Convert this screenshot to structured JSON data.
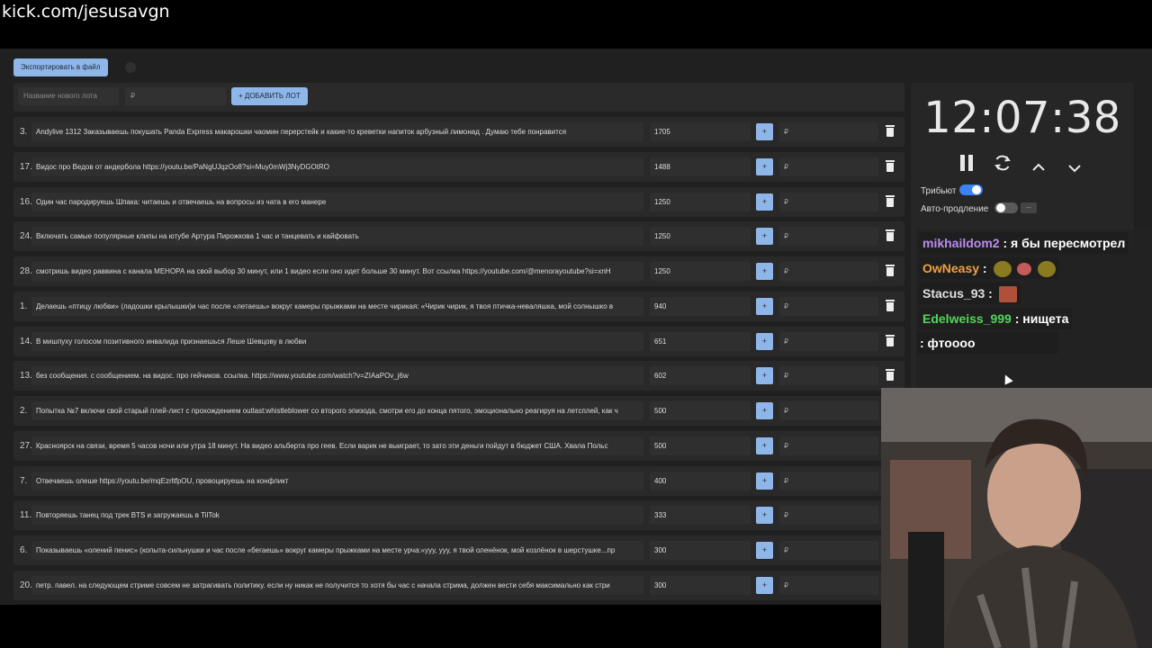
{
  "browser": {
    "url": "kick.com/jesusavgn"
  },
  "toolbar": {
    "export_label": "Экспортировать в файл"
  },
  "add_lot": {
    "name_placeholder": "Название нового лота",
    "amount_placeholder": "₽",
    "add_label": "+ ДОБАВИТЬ ЛОТ"
  },
  "lots": [
    {
      "num": "3.",
      "text": "Andylive 1312 Заказываешь покушать Panda Express макарошки чаомин перерстейк и какие-то креветки напиток арбузный лимонад . Думаю тебе понравится",
      "amount": "1705",
      "plus": "+",
      "currency": "₽"
    },
    {
      "num": "17.",
      "text": "Видос про Ведов от андербола https://youtu.be/PaNgUJqzOo8?si=Muy0mWj3NyDGOtRO",
      "amount": "1488",
      "plus": "+",
      "currency": "₽"
    },
    {
      "num": "16.",
      "text": "Один час пародируешь Шпака: читаешь и отвечаешь на вопросы из чата в его манере",
      "amount": "1250",
      "plus": "+",
      "currency": "₽"
    },
    {
      "num": "24.",
      "text": "Включать самые популярные клипы на ютубе Артура Пирожкова 1 час и танцевать и кайфовать",
      "amount": "1250",
      "plus": "+",
      "currency": "₽"
    },
    {
      "num": "28.",
      "text": "смотришь видео раввина с канала МЕНОРА на свой выбор 30 минут, или 1 видео если оно идет больше 30 минут. Вот ссылка https://youtube.com/@menorayoutube?si=xnH",
      "amount": "1250",
      "plus": "+",
      "currency": "₽"
    },
    {
      "num": "1.",
      "text": "Делаешь «птицу любви» (ладошки крылышки)и час после «летаешь» вокруг камеры прыжками на месте чирикая: «Чирик чирик, я твоя птичка-неваляшка, мой солнышко в",
      "amount": "940",
      "plus": "+",
      "currency": "₽"
    },
    {
      "num": "14.",
      "text": "В мишпуху голосом позитивного инвалида признаешься Лешe Шевцову в любви",
      "amount": "651",
      "plus": "+",
      "currency": "₽"
    },
    {
      "num": "13.",
      "text": "без сообщения. с сообщением. на видос. про гейчиков. ссылка. https://www.youtube.com/watch?v=ZIAaPOv_j6w",
      "amount": "602",
      "plus": "+",
      "currency": "₽"
    },
    {
      "num": "2.",
      "text": "Попытка №7 включи свой старый плей-лист с прохождением outlast:whistleblower со второго эпизода, смотри его до конца пятого, эмоционально реагируя на летсплей, как ч",
      "amount": "500",
      "plus": "+",
      "currency": "₽"
    },
    {
      "num": "27.",
      "text": "Красноярск на связи, время 5 часов ночи или утра 18 минут. На видео альберта про геев. Если варик не выиграет, то зато эти деньги пойдут в бюджет США. Хвала Польс",
      "amount": "500",
      "plus": "+",
      "currency": "₽"
    },
    {
      "num": "7.",
      "text": "Отвечаешь олеше https://youtu.be/mqEzrltfpOU, провоцируешь на конфликт",
      "amount": "400",
      "plus": "+",
      "currency": "₽"
    },
    {
      "num": "11.",
      "text": "Повторяешь танец под трек BTS и загружаешь в TilTok",
      "amount": "333",
      "plus": "+",
      "currency": "₽"
    },
    {
      "num": "6.",
      "text": "Показываешь «олений пенис» (копыта-сильнушки и час после «бегаешь» вокруг камеры прыжками на месте урча:«ууу, ууу, я твой оленёнок, мой козлёнок в шерстушке...пр",
      "amount": "300",
      "plus": "+",
      "currency": "₽"
    },
    {
      "num": "20.",
      "text": "петр. павел. на следующем стриме совсем не затрагивать политику. если ну никак не получится то хотя бы час с начала стрима, должен вести себя максимально как стри",
      "amount": "300",
      "plus": "+",
      "currency": "₽"
    }
  ],
  "timer": {
    "time": "12:07:38",
    "pause_icon": "pause-icon",
    "reset_icon": "refresh-icon",
    "up_icon": "chevron-up-icon",
    "down_icon": "chevron-down-icon"
  },
  "settings": {
    "tribute_label": "Трибьют",
    "tribute_on": true,
    "auto_extend_label": "Авто-продление",
    "auto_extend_on": false,
    "more_label": "..."
  },
  "chat": [
    {
      "user": "mikhaildom2",
      "color": "#b98cf0",
      "text": " : я бы пересмотрел"
    },
    {
      "user": "OwNeasy",
      "color": "#f0a040",
      "text": " : "
    },
    {
      "user": "Stacus_93",
      "color": "#e0e0e0",
      "text": " : "
    },
    {
      "user": "Edelweiss_999",
      "color": "#52d65a",
      "text": " : нищета"
    },
    {
      "user": "",
      "color": "#ffffff",
      "text": ": фтоооо"
    }
  ],
  "colors": {
    "accent": "#8fb6e8",
    "toggle_on": "#3b82f6",
    "toggle_off": "#5a5a5a"
  }
}
